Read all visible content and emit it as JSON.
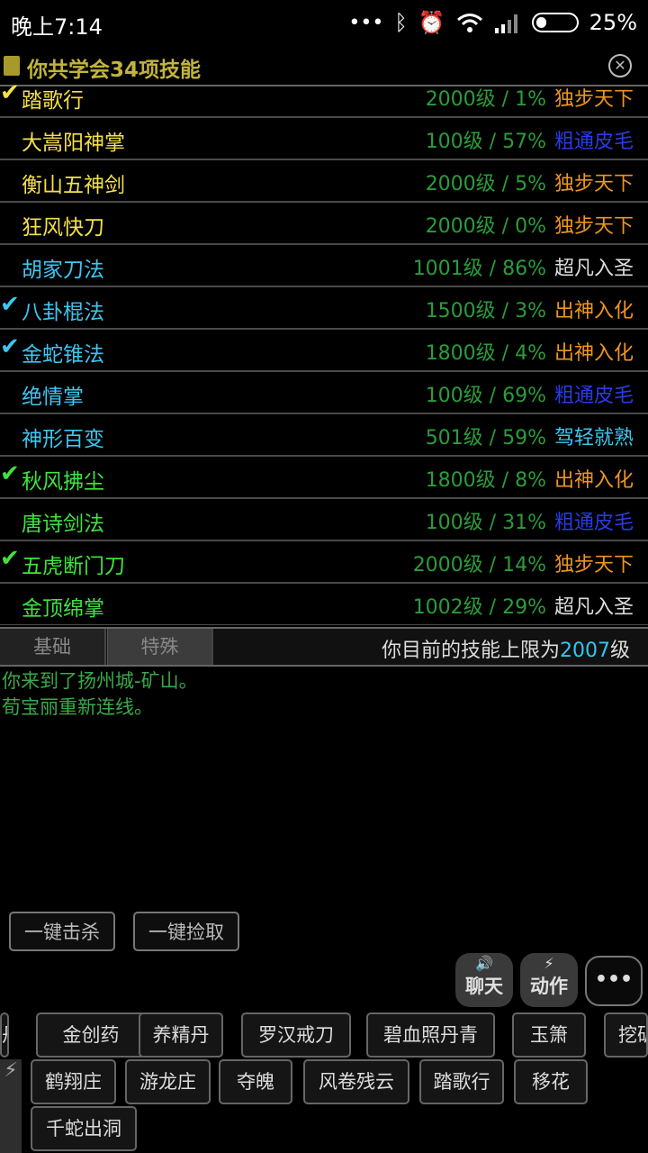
{
  "status": {
    "time": "晚上7:14",
    "battery": "25%",
    "battery_level": 0.25
  },
  "header": {
    "title": "你共学会34项技能"
  },
  "colors": {
    "yellow": "#f4e04a",
    "cyan": "#3ec6ef",
    "green": "#3fe33f",
    "level": "#2a9d3a",
    "rank_top": "#f0951e",
    "rank_blue": "#2a3be8",
    "rank_white": "#dddddd",
    "rank_cyan": "#3ec6ef"
  },
  "skills": [
    {
      "checked": true,
      "check_color": "#f4e04a",
      "name": "踏歌行",
      "name_color": "#f4e04a",
      "level": "2000级 / 1%",
      "rank": "独步天下",
      "rank_color": "#f0951e"
    },
    {
      "checked": false,
      "name": "大嵩阳神掌",
      "name_color": "#f4e04a",
      "level": "100级 / 57%",
      "rank": "粗通皮毛",
      "rank_color": "#2a3be8"
    },
    {
      "checked": false,
      "name": "衡山五神剑",
      "name_color": "#f4e04a",
      "level": "2000级 / 5%",
      "rank": "独步天下",
      "rank_color": "#f0951e"
    },
    {
      "checked": false,
      "name": "狂风快刀",
      "name_color": "#f4e04a",
      "level": "2000级 / 0%",
      "rank": "独步天下",
      "rank_color": "#f0951e"
    },
    {
      "checked": false,
      "name": "胡家刀法",
      "name_color": "#3ec6ef",
      "level": "1001级 / 86%",
      "rank": "超凡入圣",
      "rank_color": "#dddddd"
    },
    {
      "checked": true,
      "check_color": "#3ec6ef",
      "name": "八卦棍法",
      "name_color": "#3ec6ef",
      "level": "1500级 / 3%",
      "rank": "出神入化",
      "rank_color": "#f0951e"
    },
    {
      "checked": true,
      "check_color": "#3ec6ef",
      "name": "金蛇锥法",
      "name_color": "#3ec6ef",
      "level": "1800级 / 4%",
      "rank": "出神入化",
      "rank_color": "#f0951e"
    },
    {
      "checked": false,
      "name": "绝情掌",
      "name_color": "#3ec6ef",
      "level": "100级 / 69%",
      "rank": "粗通皮毛",
      "rank_color": "#2a3be8"
    },
    {
      "checked": false,
      "name": "神形百变",
      "name_color": "#3ec6ef",
      "level": "501级 / 59%",
      "rank": "驾轻就熟",
      "rank_color": "#3ec6ef"
    },
    {
      "checked": true,
      "check_color": "#3fe33f",
      "name": "秋风拂尘",
      "name_color": "#3fe33f",
      "level": "1800级 / 8%",
      "rank": "出神入化",
      "rank_color": "#f0951e"
    },
    {
      "checked": false,
      "name": "唐诗剑法",
      "name_color": "#3fe33f",
      "level": "100级 / 31%",
      "rank": "粗通皮毛",
      "rank_color": "#2a3be8"
    },
    {
      "checked": true,
      "check_color": "#3fe33f",
      "name": "五虎断门刀",
      "name_color": "#3fe33f",
      "level": "2000级 / 14%",
      "rank": "独步天下",
      "rank_color": "#f0951e"
    },
    {
      "checked": false,
      "name": "金顶绵掌",
      "name_color": "#3fe33f",
      "level": "1002级 / 29%",
      "rank": "超凡入圣",
      "rank_color": "#dddddd"
    }
  ],
  "tabs": {
    "basic": "基础",
    "special": "特殊",
    "limit_prefix": "你目前的技能上限为",
    "limit_value": "2007",
    "limit_suffix": "级"
  },
  "log": [
    "你来到了扬州城-矿山。",
    "荀宝丽重新连线。"
  ],
  "quick": {
    "kill_all": "一键击杀",
    "pick_all": "一键捡取"
  },
  "actions": {
    "chat": "聊天",
    "action": "动作",
    "more": "•••"
  },
  "chips_row1": [
    "丹",
    "金创药",
    "养精丹",
    "罗汉戒刀",
    "碧血照丹青",
    "玉箫",
    "挖矿"
  ],
  "chips_row2": [
    "鹤翔庄",
    "游龙庄",
    "夺魄",
    "风卷残云",
    "踏歌行",
    "移花"
  ],
  "chips_row3": [
    "千蛇出洞"
  ]
}
